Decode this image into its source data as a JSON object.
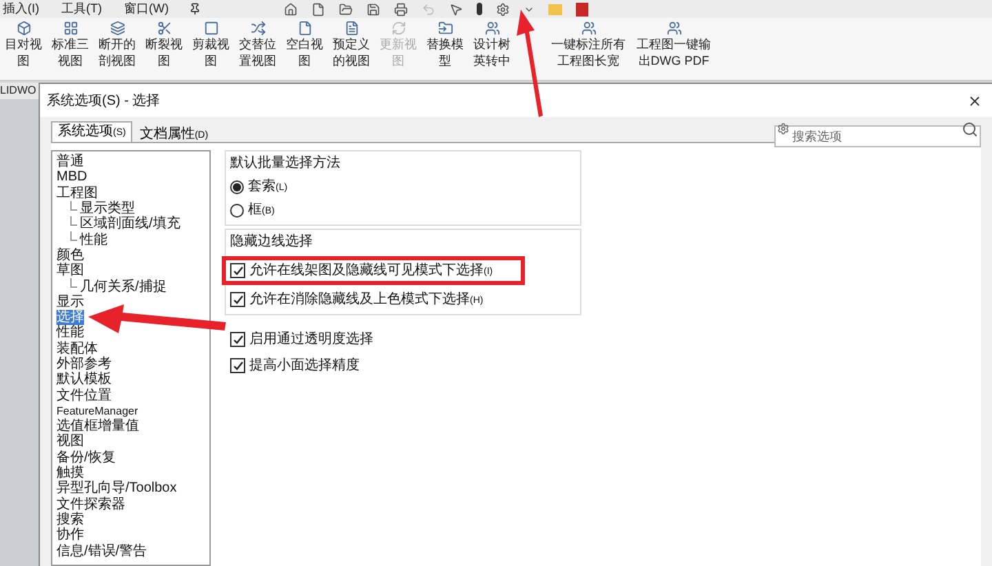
{
  "menu": [
    "插入(I)",
    "工具(T)",
    "窗口(W)"
  ],
  "ribbon": [
    {
      "label": "目对视图",
      "disabled": false
    },
    {
      "label": "标准三视图",
      "disabled": false
    },
    {
      "label": "断开的剖视图",
      "disabled": false
    },
    {
      "label": "断裂视图",
      "disabled": false
    },
    {
      "label": "剪裁视图",
      "disabled": false
    },
    {
      "label": "交替位置视图",
      "disabled": false
    },
    {
      "label": "空白视图",
      "disabled": false
    },
    {
      "label": "预定义的视图",
      "disabled": false
    },
    {
      "label": "更新视图",
      "disabled": true
    },
    {
      "label": "替换模型",
      "disabled": false
    },
    {
      "label": "设计树英转中",
      "disabled": false
    },
    {
      "label": "一键标注所有工程图长宽",
      "disabled": false
    },
    {
      "label": "工程图一键输出DWG PDF",
      "disabled": false
    }
  ],
  "side_tab": "LIDWO",
  "dialog": {
    "title": "系统选项(S) - 选择",
    "tabs": [
      {
        "label": "系统选项",
        "key": "(S)",
        "selected": true
      },
      {
        "label": "文档属性",
        "key": "(D)",
        "selected": false
      }
    ],
    "search": {
      "placeholder": "搜索选项"
    },
    "tree": [
      {
        "label": "普通",
        "selected": false
      },
      {
        "label": "MBD",
        "selected": false
      },
      {
        "label": "工程图",
        "selected": false,
        "children": [
          {
            "label": "显示类型",
            "selected": false
          },
          {
            "label": "区域剖面线/填充",
            "selected": false
          },
          {
            "label": "性能",
            "selected": false
          }
        ]
      },
      {
        "label": "颜色",
        "selected": false
      },
      {
        "label": "草图",
        "selected": false,
        "children": [
          {
            "label": "几何关系/捕捉",
            "selected": false
          }
        ]
      },
      {
        "label": "显示",
        "selected": false
      },
      {
        "label": "选择",
        "selected": true
      },
      {
        "label": "性能",
        "selected": false
      },
      {
        "label": "装配体",
        "selected": false
      },
      {
        "label": "外部参考",
        "selected": false
      },
      {
        "label": "默认模板",
        "selected": false
      },
      {
        "label": "文件位置",
        "selected": false
      },
      {
        "label": "FeatureManager",
        "selected": false
      },
      {
        "label": "选值框增量值",
        "selected": false
      },
      {
        "label": "视图",
        "selected": false
      },
      {
        "label": "备份/恢复",
        "selected": false
      },
      {
        "label": "触摸",
        "selected": false
      },
      {
        "label": "异型孔向导/Toolbox",
        "selected": false
      },
      {
        "label": "文件探索器",
        "selected": false
      },
      {
        "label": "搜索",
        "selected": false
      },
      {
        "label": "协作",
        "selected": false
      },
      {
        "label": "信息/错误/警告",
        "selected": false
      }
    ],
    "batch_group": {
      "title": "默认批量选择方法",
      "options": [
        {
          "label": "套索",
          "key": "(L)",
          "selected": true
        },
        {
          "label": "框",
          "key": "(B)",
          "selected": false
        }
      ]
    },
    "hidden_group": {
      "title": "隐藏边线选择",
      "options": [
        {
          "label": "允许在线架图及隐藏线可见模式下选择",
          "key": "(I)",
          "checked": true,
          "highlighted": true
        },
        {
          "label": "允许在消除隐藏线及上色模式下选择",
          "key": "(H)",
          "checked": true,
          "highlighted": false
        }
      ]
    },
    "extra_options": [
      {
        "label": "启用通过透明度选择",
        "checked": true
      },
      {
        "label": "提高小面选择精度",
        "checked": true
      }
    ]
  }
}
